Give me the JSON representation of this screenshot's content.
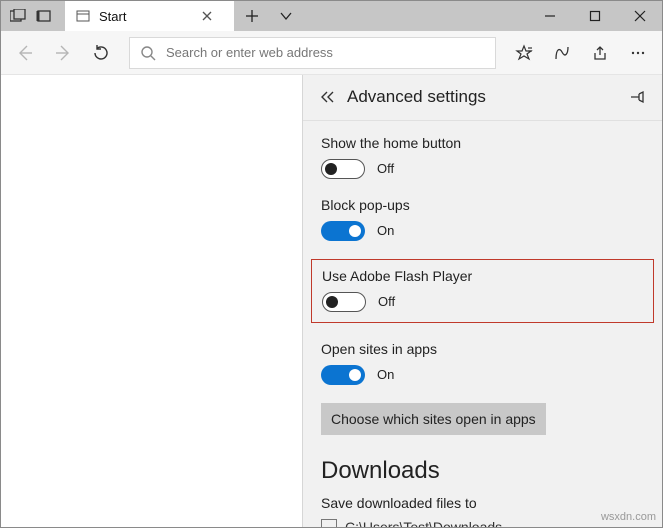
{
  "titlebar": {
    "tab_title": "Start"
  },
  "toolbar": {
    "search_placeholder": "Search or enter web address"
  },
  "panel": {
    "title": "Advanced settings",
    "settings": {
      "home_button": {
        "label": "Show the home button",
        "state": "Off"
      },
      "popups": {
        "label": "Block pop-ups",
        "state": "On"
      },
      "flash": {
        "label": "Use Adobe Flash Player",
        "state": "Off"
      },
      "open_apps": {
        "label": "Open sites in apps",
        "state": "On"
      }
    },
    "choose_sites_button": "Choose which sites open in apps",
    "downloads_heading": "Downloads",
    "save_files_label": "Save downloaded files to",
    "save_files_path": "C:\\Users\\Test\\Downloads"
  },
  "watermark": "wsxdn.com"
}
